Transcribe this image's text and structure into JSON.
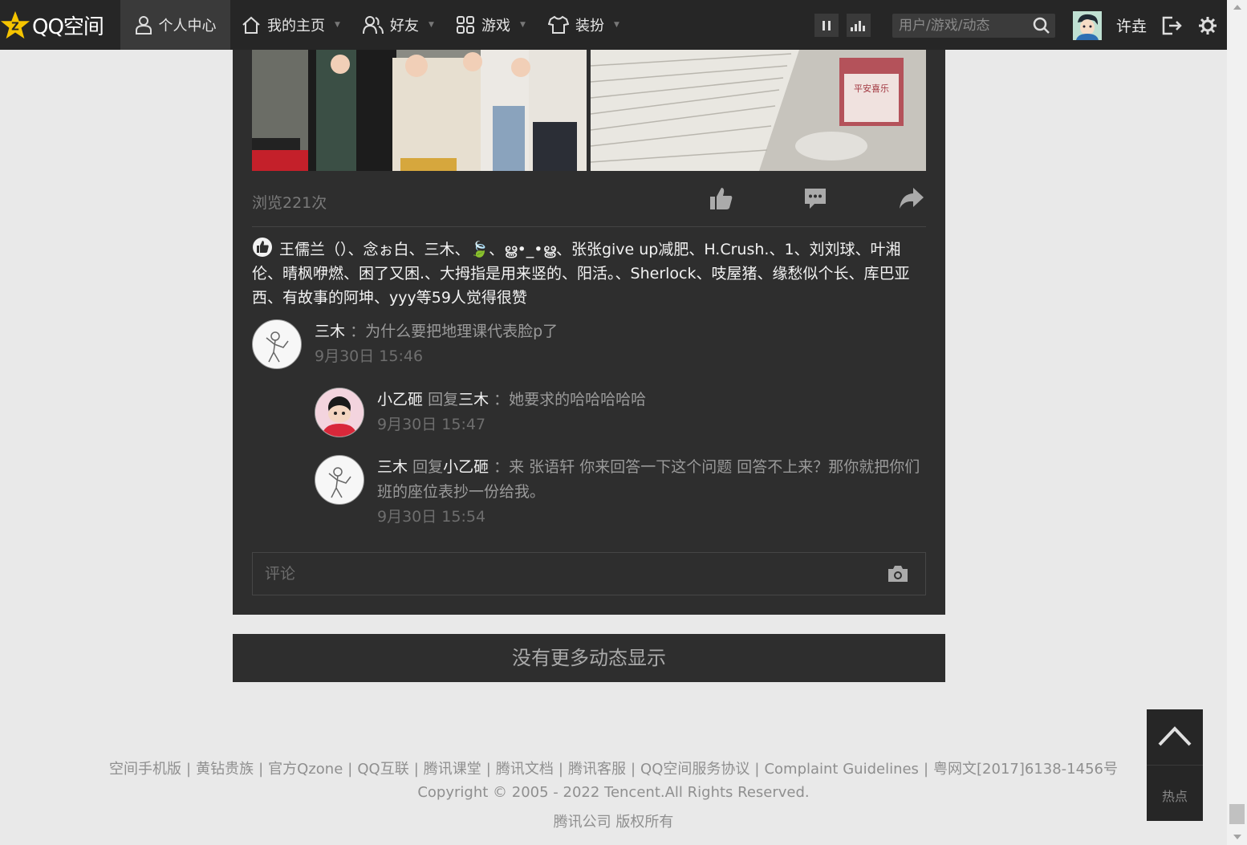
{
  "topbar": {
    "logo_text": "QQ空间",
    "nav": [
      {
        "label": "个人中心",
        "icon": "person-icon",
        "active": true
      },
      {
        "label": "我的主页",
        "icon": "home-icon"
      },
      {
        "label": "好友",
        "icon": "friends-icon"
      },
      {
        "label": "游戏",
        "icon": "grid-icon"
      },
      {
        "label": "装扮",
        "icon": "shirt-icon"
      }
    ],
    "search_placeholder": "用户/游戏/动态",
    "username": "许垚",
    "icons": [
      "pause-icon",
      "stats-icon",
      "search-icon",
      "logout-icon",
      "gear-icon"
    ]
  },
  "post": {
    "views": "浏览221次",
    "likes_text": "王儒兰（）、念ぉ白、三木、🍃、ൠ•_•ൠ、张张give up减肥、H.Crush.、1、刘刘球、叶湘伦、晴枫咿燃、困了又困.、大拇指是用来竖的、阳活。、Sherlock、吱屋猪、缘愁似个长、库巴亚西、有故事的阿坤、yyy等59人觉得很赞",
    "comments": [
      {
        "name": "三木",
        "reply_word": "",
        "reply_to": "",
        "text": "：为什么要把地理课代表脸p了",
        "time": "9月30日 15:46"
      },
      {
        "name": "小乙砸",
        "reply_word": "回复",
        "reply_to": "三木",
        "text": "：她要求的哈哈哈哈哈",
        "time": "9月30日 15:47"
      },
      {
        "name": "三木",
        "reply_word": "回复",
        "reply_to": "小乙砸",
        "text": "：来 张语轩 你来回答一下这个问题 回答不上来？那你就把你们班的座位表抄一份给我。",
        "time": "9月30日 15:54"
      }
    ],
    "comment_placeholder": "评论"
  },
  "nomore": "没有更多动态显示",
  "footer": {
    "links": [
      "空间手机版",
      "黄钻贵族",
      "官方Qzone",
      "QQ互联",
      "腾讯课堂",
      "腾讯文档",
      "腾讯客服",
      "QQ空间服务协议",
      "Complaint Guidelines",
      "粤网文[2017]6138-1456号"
    ],
    "copyright": "Copyright © 2005 - 2022 Tencent.All Rights Reserved.",
    "company": "腾讯公司 版权所有"
  },
  "side_widget": {
    "hot_label": "热点"
  },
  "colors": {
    "bg": "#e9e9e9",
    "bar": "#262626",
    "card": "#2e2e2e",
    "logo_yellow": "#f5c400"
  }
}
